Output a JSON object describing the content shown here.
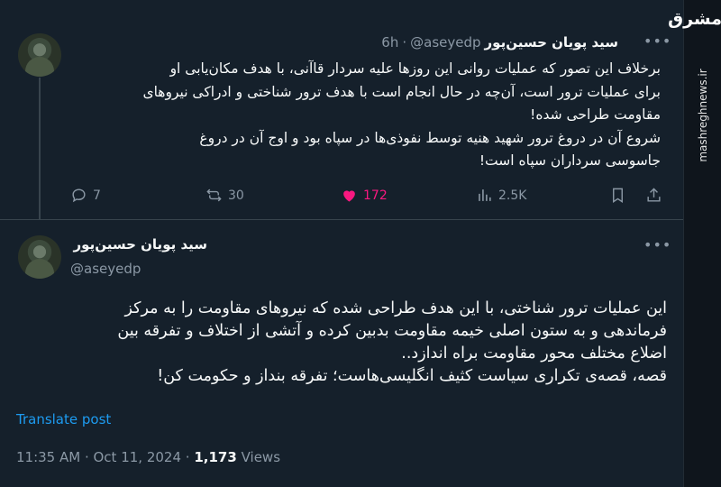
{
  "tweet1": {
    "author_name": "سید پویان حسین‌پور",
    "handle": "@aseyedp",
    "separator": "·",
    "time": "6h",
    "lines": [
      "برخلاف این تصور که عملیات روانی این روزها علیه سردار قاآنی، با هدف مکان‌یابی او",
      "برای عملیات ترور است، آن‌چه در حال انجام است با هدف ترور شناختی و ادراکی نیروهای",
      "مقاومت طراحی شده!",
      "شروع آن در دروغ ترور شهید هنیه توسط نفوذی‌ها در سپاه بود و اوج آن در دروغ",
      "جاسوسی سرداران سپاه است!"
    ],
    "replies": "7",
    "reposts": "30",
    "likes": "172",
    "views": "2.5K"
  },
  "tweet2": {
    "author_name": "سید پویان حسین‌پور",
    "handle": "@aseyedp",
    "lines": [
      "این عملیات ترور شناختی، با این هدف طراحی شده که نیروهای مقاومت را به مرکز",
      "فرماندهی و به ستون اصلی خیمه مقاومت بدبین کرده و آتشی از اختلاف و تفرقه بین",
      "اضلاع مختلف محور مقاومت براه اندازد..",
      "قصه، قصه‌ی تکراری سیاست کثیف انگلیسی‌هاست؛ تفرقه بنداز و حکومت کن!"
    ],
    "translate_label": "Translate post",
    "timestamp": "11:35 AM · Oct 11, 2024",
    "views_sep": "·",
    "views_count": "1,173",
    "views_label": "Views"
  },
  "watermark": {
    "logo": "مشرق",
    "site": "mashreghnews.ir"
  },
  "colors": {
    "background": "#15202b",
    "text": "#f7f9f9",
    "muted": "#8b98a5",
    "accent": "#1d9bf0",
    "like": "#f91880"
  }
}
